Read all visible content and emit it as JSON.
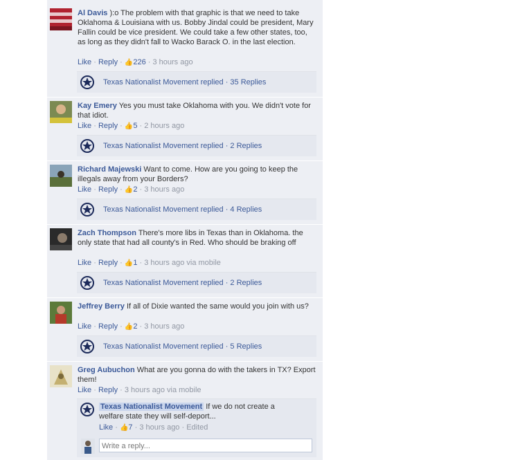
{
  "comments": [
    {
      "author": "Al Davis",
      "text": "):o The problem with that graphic is that we need to take Oklahoma & Louisiana with us. Bobby Jindal could be president, Mary Fallin could be vice president. We could take a few other states, too, as long as they didn't fall to Wacko Barack O. in the last election.",
      "like": "Like",
      "reply": "Reply",
      "likes": "226",
      "time": "3 hours ago",
      "replies_text": "Texas Nationalist Movement replied",
      "replies_count": "35 Replies"
    },
    {
      "author": "Kay Emery",
      "text": "Yes you must take Oklahoma with you. We didn't vote for that idiot.",
      "like": "Like",
      "reply": "Reply",
      "likes": "5",
      "time": "2 hours ago",
      "replies_text": "Texas Nationalist Movement replied",
      "replies_count": "2 Replies"
    },
    {
      "author": "Richard Majewski",
      "text": "Want to come. How are you going to keep the illegals away from your Borders?",
      "like": "Like",
      "reply": "Reply",
      "likes": "2",
      "time": "3 hours ago",
      "replies_text": "Texas Nationalist Movement replied",
      "replies_count": "4 Replies"
    },
    {
      "author": "Zach Thompson",
      "text": "There's more libs in Texas than in Oklahoma. the only state that had all county's in Red. Who should be braking off",
      "like": "Like",
      "reply": "Reply",
      "likes": "1",
      "time": "3 hours ago via mobile",
      "replies_text": "Texas Nationalist Movement replied",
      "replies_count": "2 Replies"
    },
    {
      "author": "Jeffrey Berry",
      "text": "If all of Dixie wanted the same would you join with us?",
      "like": "Like",
      "reply": "Reply",
      "likes": "2",
      "time": "3 hours ago",
      "replies_text": "Texas Nationalist Movement replied",
      "replies_count": "5 Replies"
    },
    {
      "author": "Greg Aubuchon",
      "text": "What are you gonna do with the takers in TX? Export them!",
      "like": "Like",
      "reply": "Reply",
      "time": "3 hours ago via mobile"
    }
  ],
  "nested_reply": {
    "author": "Texas Nationalist Movement",
    "text": "If we do not create a welfare state they will self-deport...",
    "like": "Like",
    "likes": "7",
    "time": "3 hours ago",
    "edited": "Edited"
  },
  "reply_input": {
    "placeholder": "Write a reply..."
  },
  "sep": " · ",
  "colors": {
    "link": "#3b5998",
    "panel": "#edeff4",
    "meta": "#9197a3"
  },
  "icons": {
    "like": "thumbs-up-icon",
    "page": "tnm-star-logo-icon"
  }
}
